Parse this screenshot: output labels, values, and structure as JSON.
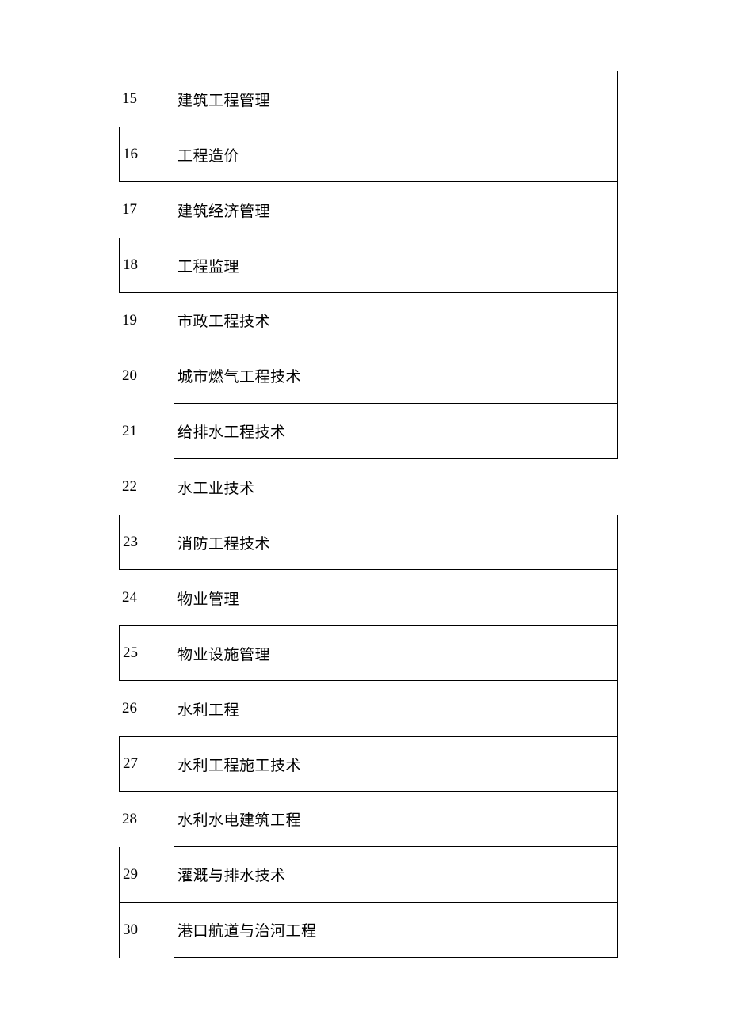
{
  "rows": [
    {
      "num": "15",
      "text": "建筑工程管理"
    },
    {
      "num": "16",
      "text": "工程造价"
    },
    {
      "num": "17",
      "text": "建筑经济管理"
    },
    {
      "num": "18",
      "text": "工程监理"
    },
    {
      "num": "19",
      "text": "市政工程技术"
    },
    {
      "num": "20",
      "text": "城市燃气工程技术"
    },
    {
      "num": "21",
      "text": "给排水工程技术"
    },
    {
      "num": "22",
      "text": "水工业技术"
    },
    {
      "num": "23",
      "text": "消防工程技术"
    },
    {
      "num": "24",
      "text": "物业管理"
    },
    {
      "num": "25",
      "text": "物业设施管理"
    },
    {
      "num": "26",
      "text": "水利工程"
    },
    {
      "num": "27",
      "text": "水利工程施工技术"
    },
    {
      "num": "28",
      "text": "水利水电建筑工程"
    },
    {
      "num": "29",
      "text": "灌溉与排水技术"
    },
    {
      "num": "30",
      "text": "港口航道与治河工程"
    }
  ]
}
